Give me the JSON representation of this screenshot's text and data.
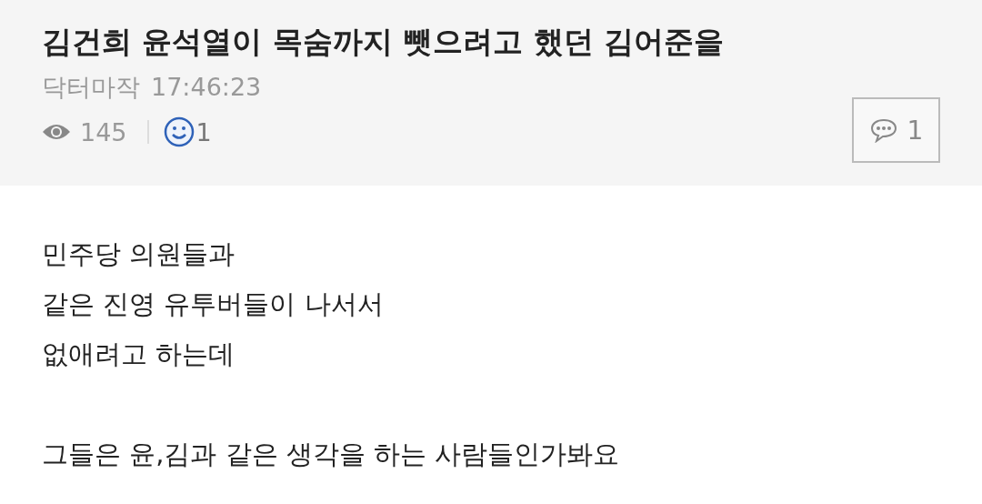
{
  "post": {
    "title": "김건희 윤석열이 목숨까지 뺏으려고 했던 김어준을",
    "author": "닥터마작",
    "time": "17:46:23",
    "views": "145",
    "likes": "1",
    "comments": "1"
  },
  "body": {
    "paragraphs": [
      [
        "민주당 의원들과",
        "같은 진영 유투버들이 나서서",
        "없애려고 하는데"
      ],
      [
        "그들은 윤,김과 같은 생각을 하는 사람들인가봐요"
      ]
    ]
  }
}
